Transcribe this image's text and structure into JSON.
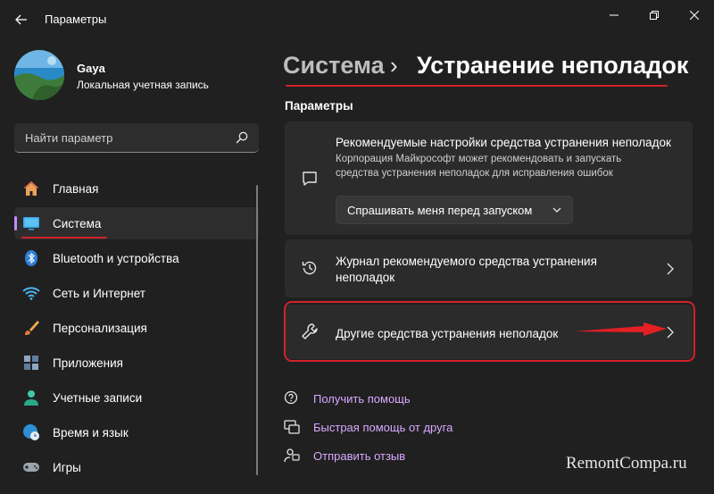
{
  "window": {
    "title": "Параметры"
  },
  "user": {
    "name": "Gaya",
    "account_type": "Локальная учетная запись"
  },
  "search": {
    "placeholder": "Найти параметр"
  },
  "sidebar": {
    "items": [
      {
        "label": "Главная",
        "icon": "home-icon"
      },
      {
        "label": "Система",
        "icon": "monitor-icon",
        "active": true
      },
      {
        "label": "Bluetooth и устройства",
        "icon": "bluetooth-icon"
      },
      {
        "label": "Сеть и Интернет",
        "icon": "wifi-icon"
      },
      {
        "label": "Персонализация",
        "icon": "brush-icon"
      },
      {
        "label": "Приложения",
        "icon": "apps-icon"
      },
      {
        "label": "Учетные записи",
        "icon": "person-icon"
      },
      {
        "label": "Время и язык",
        "icon": "globe-clock-icon"
      },
      {
        "label": "Игры",
        "icon": "gamepad-icon"
      }
    ]
  },
  "breadcrumb": {
    "parent": "Система",
    "separator": "›",
    "current": "Устранение неполадок"
  },
  "section": {
    "title": "Параметры"
  },
  "cards": {
    "recommended": {
      "title": "Рекомендуемые настройки средства устранения неполадок",
      "desc_line1": "Корпорация Майкрософт может рекомендовать и запускать",
      "desc_line2": "средства устранения неполадок для исправления ошибок",
      "dropdown_value": "Спрашивать меня перед запуском"
    },
    "history": {
      "title_line1": "Журнал рекомендуемого средства устранения",
      "title_line2": "неполадок"
    },
    "other": {
      "title": "Другие средства устранения неполадок"
    }
  },
  "help_links": {
    "get_help": "Получить помощь",
    "quick_assist": "Быстрая помощь от друга",
    "feedback": "Отправить отзыв"
  },
  "watermark": "RemontCompa.ru",
  "colors": {
    "accent": "#c38cff",
    "annotation": "#d3222a",
    "link": "#d8a9ff",
    "background": "#202020",
    "card": "#2b2b2b"
  }
}
